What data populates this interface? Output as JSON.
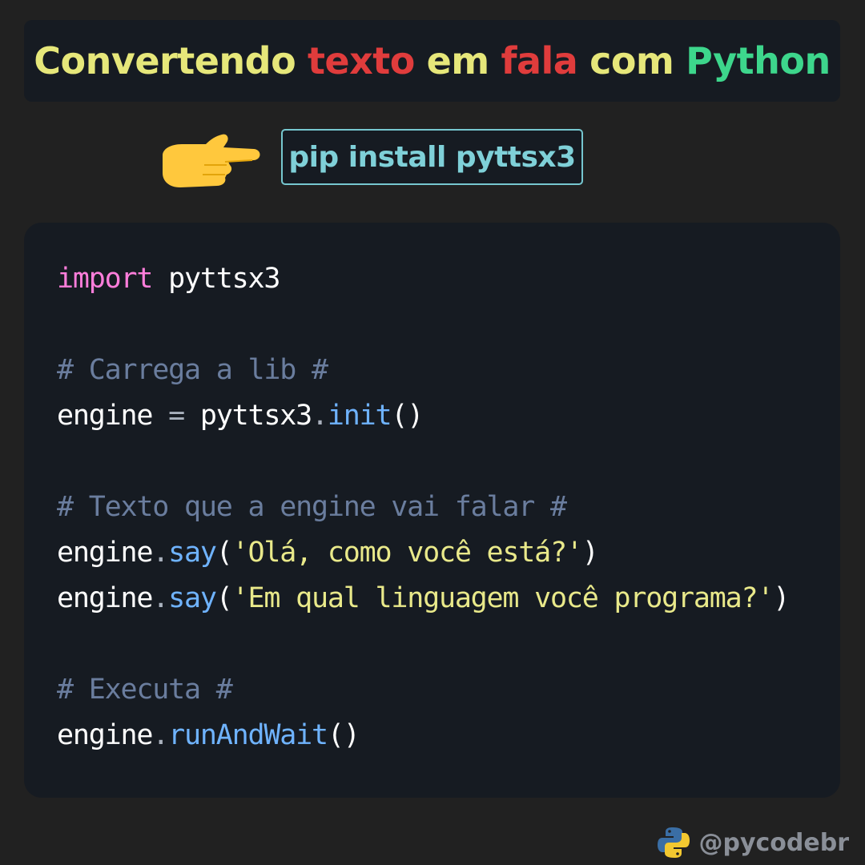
{
  "header": {
    "title_parts": [
      {
        "text": "Convertendo",
        "color": "#e6e77a"
      },
      {
        "text": "texto",
        "color": "#e03c3c"
      },
      {
        "text": "em",
        "color": "#e6e77a"
      },
      {
        "text": "fala",
        "color": "#e03c3c"
      },
      {
        "text": "com",
        "color": "#e6e77a"
      },
      {
        "text": "Python",
        "color": "#3dd68c"
      }
    ]
  },
  "install": {
    "pointer_icon": "pointing-hand-icon",
    "command": "pip install pyttsx3"
  },
  "code": {
    "line1": {
      "keyword": "import",
      "module": " pyttsx3"
    },
    "comment1": "# Carrega a lib #",
    "line2": {
      "var": "engine",
      "op": " = ",
      "obj": "pyttsx3",
      "dot": ".",
      "method": "init",
      "parens": "()"
    },
    "comment2": "# Texto que a engine vai falar #",
    "line3": {
      "var": "engine",
      "dot": ".",
      "method": "say",
      "open": "(",
      "arg": "'Olá, como você está?'",
      "close": ")"
    },
    "line4": {
      "var": "engine",
      "dot": ".",
      "method": "say",
      "open": "(",
      "arg": "'Em qual linguagem você programa?'",
      "close": ")"
    },
    "comment3": "# Executa #",
    "line5": {
      "var": "engine",
      "dot": ".",
      "method": "runAndWait",
      "parens": "()"
    }
  },
  "footer": {
    "logo_icon": "python-logo-icon",
    "handle": "@pycodebr"
  },
  "colors": {
    "background": "#212121",
    "panel": "#161b22",
    "keyword": "#ff7edb",
    "comment": "#6a7d9e",
    "function": "#6fb3ff",
    "string": "#e9e98a",
    "accent_cyan": "#76c7cf"
  }
}
